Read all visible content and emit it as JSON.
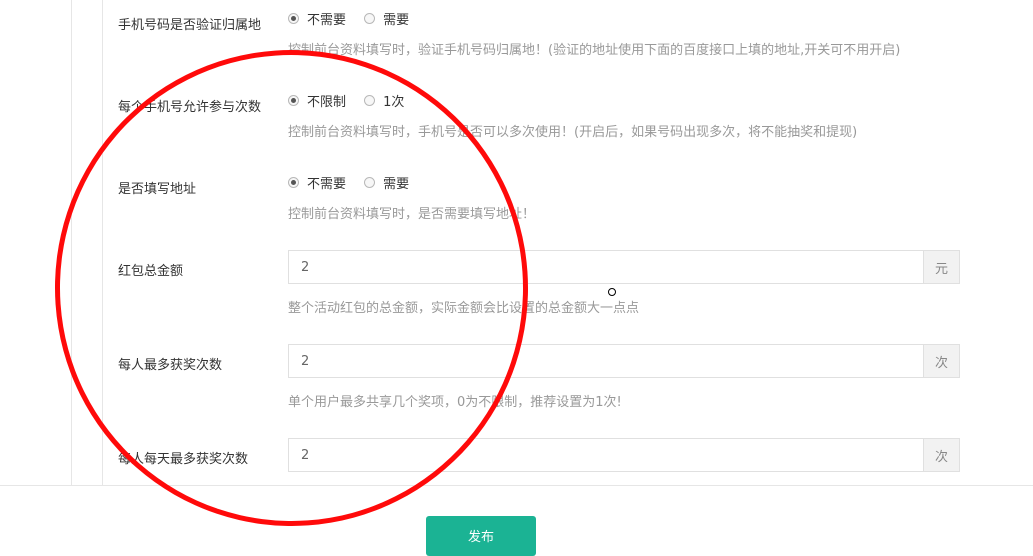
{
  "form": {
    "rows": [
      {
        "label": "手机号码是否验证归属地",
        "options": [
          "不需要",
          "需要"
        ],
        "selected": 0,
        "help": "控制前台资料填写时，验证手机号码归属地！(验证的地址使用下面的百度接口上填的地址,开关可不用开启)"
      },
      {
        "label": "每个手机号允许参与次数",
        "options": [
          "不限制",
          "1次"
        ],
        "selected": 0,
        "help": "控制前台资料填写时，手机号是否可以多次使用！(开启后，如果号码出现多次，将不能抽奖和提现)"
      },
      {
        "label": "是否填写地址",
        "options": [
          "不需要",
          "需要"
        ],
        "selected": 0,
        "help": "控制前台资料填写时，是否需要填写地址！"
      }
    ],
    "inputs": [
      {
        "label": "红包总金额",
        "value": "2",
        "addon": "元",
        "help": "整个活动红包的总金额，实际金额会比设置的总金额大一点点"
      },
      {
        "label": "每人最多获奖次数",
        "value": "2",
        "addon": "次",
        "help": "单个用户最多共享几个奖项，0为不限制，推荐设置为1次!"
      },
      {
        "label": "每人每天最多获奖次数",
        "value": "2",
        "addon": "次"
      }
    ],
    "publish_label": "发布"
  },
  "colors": {
    "primary": "#1bb394",
    "annotation": "#ff0a0a",
    "help_text": "#999999"
  }
}
